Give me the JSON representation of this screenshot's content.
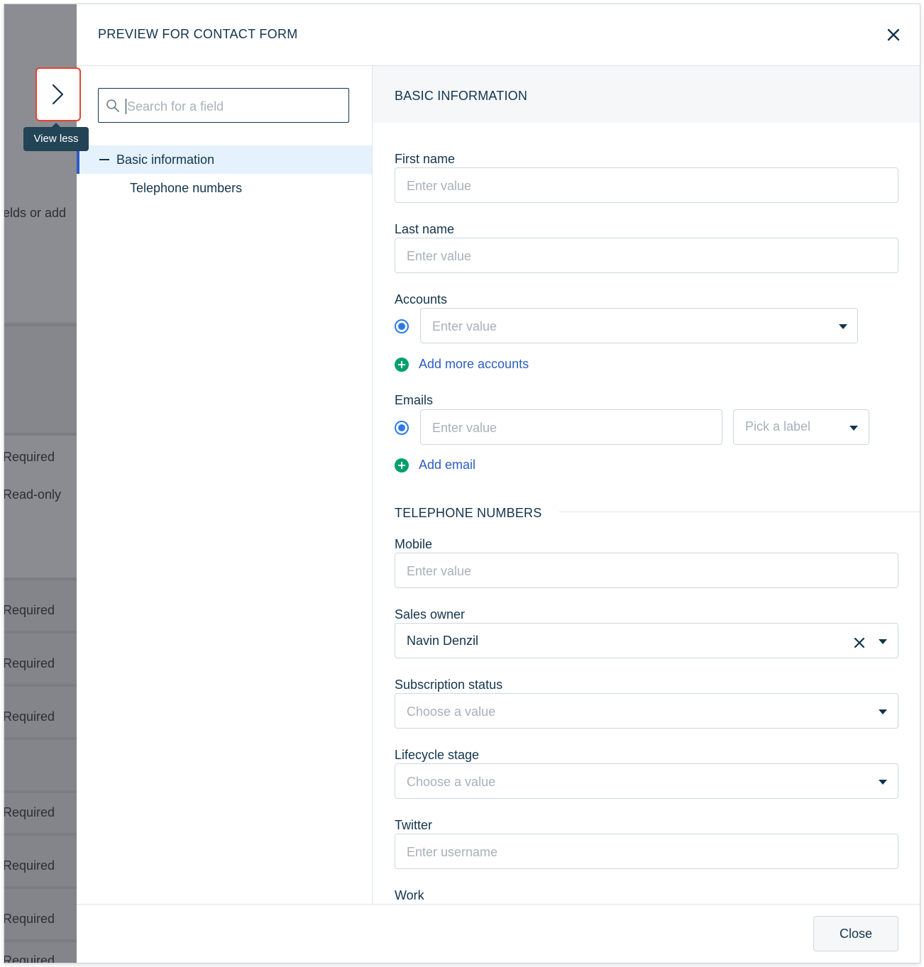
{
  "background": {
    "text_fields": "ields or add",
    "required": "Required",
    "read_only": "Read-only",
    "cut_required": "Required"
  },
  "drawer": {
    "title": "PREVIEW FOR CONTACT FORM",
    "close_icon": "close-icon",
    "toggle": {
      "icon": "chevron-right-icon",
      "tooltip": "View less"
    },
    "search": {
      "placeholder": "Search for a field",
      "value": ""
    },
    "nav": {
      "active": "Basic information",
      "sub": "Telephone numbers"
    },
    "sections": {
      "basic": "BASIC INFORMATION",
      "telephone": "TELEPHONE NUMBERS"
    },
    "fields": {
      "first_name": {
        "label": "First name",
        "placeholder": "Enter value"
      },
      "last_name": {
        "label": "Last name",
        "placeholder": "Enter value"
      },
      "accounts": {
        "label": "Accounts",
        "placeholder": "Enter value",
        "add_link": "Add more accounts"
      },
      "emails": {
        "label": "Emails",
        "placeholder": "Enter value",
        "label_placeholder": "Pick a label",
        "add_link": "Add email"
      },
      "mobile": {
        "label": "Mobile",
        "placeholder": "Enter value"
      },
      "sales_owner": {
        "label": "Sales owner",
        "value": "Navin Denzil"
      },
      "subscription_status": {
        "label": "Subscription status",
        "placeholder": "Choose a value"
      },
      "lifecycle_stage": {
        "label": "Lifecycle stage",
        "placeholder": "Choose a value"
      },
      "twitter": {
        "label": "Twitter",
        "placeholder": "Enter username"
      },
      "work": {
        "label": "Work"
      }
    },
    "footer": {
      "close_label": "Close"
    }
  },
  "colors": {
    "primary_text": "#12344d",
    "link": "#2c5cc5",
    "add_icon": "#00a06b",
    "radio": "#2c7be5",
    "toggle_border": "#e5432f",
    "tooltip_bg": "#234456"
  }
}
